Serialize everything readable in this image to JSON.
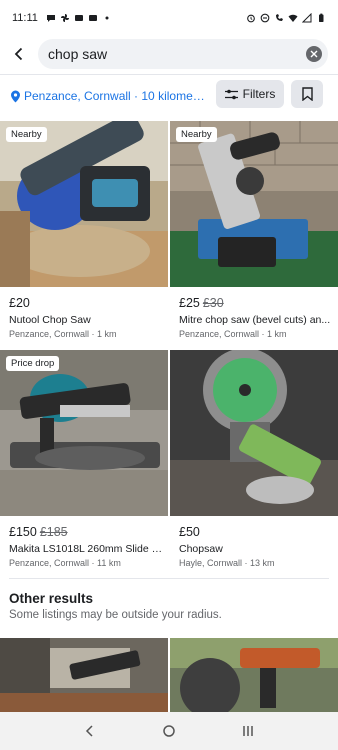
{
  "status": {
    "time": "11:11"
  },
  "search": {
    "query": "chop saw"
  },
  "location": {
    "label": "Penzance, Cornwall · 10 kilometr..."
  },
  "toolbar": {
    "filters_label": "Filters"
  },
  "listings": [
    {
      "badge": "Nearby",
      "price": "£20",
      "old_price": "",
      "title": "Nutool Chop Saw",
      "location": "Penzance, Cornwall · 1 km"
    },
    {
      "badge": "Nearby",
      "price": "£25",
      "old_price": "£30",
      "title": "Mitre chop saw (bevel cuts) an...",
      "location": "Penzance, Cornwall · 1 km"
    },
    {
      "badge": "Price drop",
      "price": "£150",
      "old_price": "£185",
      "title": "Makita LS1018L 260mm Slide C...",
      "location": "Penzance, Cornwall · 11 km"
    },
    {
      "badge": "",
      "price": "£50",
      "old_price": "",
      "title": "Chopsaw",
      "location": "Hayle, Cornwall · 13 km"
    }
  ],
  "other_results": {
    "heading": "Other results",
    "subtitle": "Some listings may be outside your radius."
  },
  "colors": {
    "accent": "#1b74e4",
    "chip_bg": "#e4e6eb",
    "search_bg": "#f0f2f5"
  }
}
